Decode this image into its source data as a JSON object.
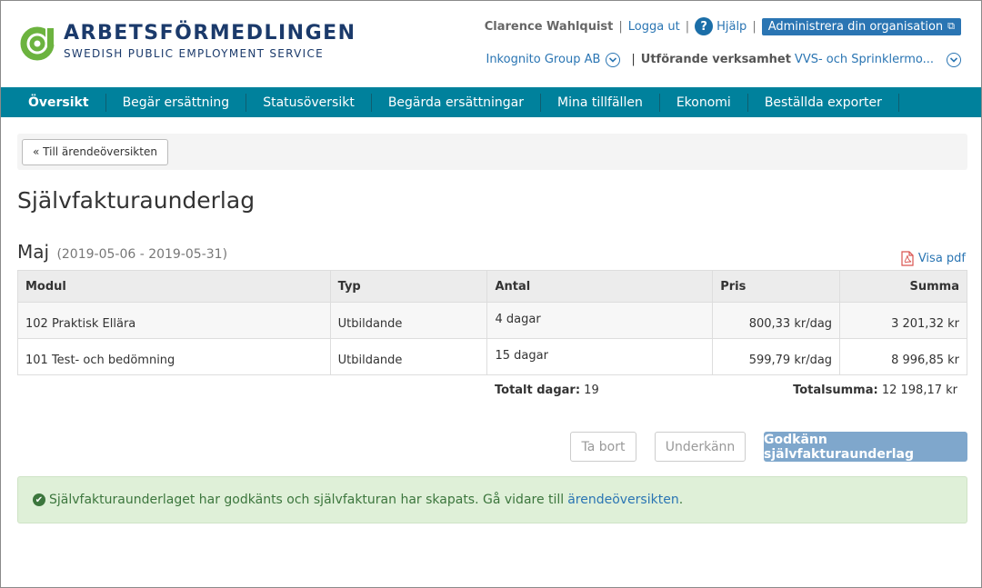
{
  "brand": {
    "name": "ARBETSFÖRMEDLINGEN",
    "tagline": "SWEDISH PUBLIC EMPLOYMENT SERVICE",
    "color": "#1b3a6b",
    "accent": "#6cb33f"
  },
  "userbar": {
    "user_name": "Clarence Wahlquist",
    "logout": "Logga ut",
    "help": "Hjälp",
    "admin": "Administrera din organisation"
  },
  "orgbar": {
    "organization": "Inkognito Group AB",
    "activity_label": "Utförande verksamhet",
    "activity_value": "VVS- och Sprinklermo..."
  },
  "nav": {
    "items": [
      {
        "label": "Översikt"
      },
      {
        "label": "Begär ersättning"
      },
      {
        "label": "Statusöversikt"
      },
      {
        "label": "Begärda ersättningar"
      },
      {
        "label": "Mina tillfällen"
      },
      {
        "label": "Ekonomi"
      },
      {
        "label": "Beställda exporter"
      }
    ],
    "color": "#00819c"
  },
  "back_button": "« Till ärendeöversikten",
  "page_title": "Självfakturaunderlag",
  "section": {
    "month": "Maj",
    "range": "(2019-05-06 - 2019-05-31)",
    "pdf_link": "Visa pdf"
  },
  "table": {
    "headers": [
      "Modul",
      "Typ",
      "Antal",
      "Pris",
      "Summa"
    ],
    "rows": [
      {
        "modul": "102 Praktisk Ellära",
        "typ": "Utbildande",
        "antal": "4 dagar",
        "pris": "800,33 kr/dag",
        "summa": "3 201,32 kr"
      },
      {
        "modul": "101 Test- och bedömning",
        "typ": "Utbildande",
        "antal": "15 dagar",
        "pris": "599,79 kr/dag",
        "summa": "8 996,85 kr"
      }
    ]
  },
  "totals": {
    "days_label": "Totalt dagar:",
    "days_value": "19",
    "sum_label": "Totalsumma:",
    "sum_value": "12 198,17 kr"
  },
  "actions": {
    "delete": "Ta bort",
    "reject": "Underkänn",
    "approve": "Godkänn självfakturaunderlag"
  },
  "alert": {
    "text": "Självfakturaunderlaget har godkänts och självfakturan har skapats. Gå vidare till ",
    "link": "ärendeöversikten",
    "suffix": "."
  }
}
